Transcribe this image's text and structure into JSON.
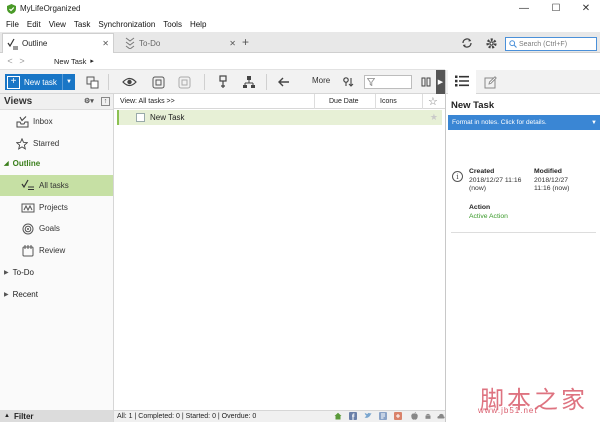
{
  "window": {
    "title": "MyLifeOrganized",
    "minimize": "—",
    "maximize": "☐",
    "close": "✕"
  },
  "menu": [
    "File",
    "Edit",
    "View",
    "Task",
    "Synchronization",
    "Tools",
    "Help"
  ],
  "tabs": [
    {
      "label": "Outline",
      "close": "✕",
      "active": true
    },
    {
      "label": "To-Do",
      "close": "✕",
      "active": false
    }
  ],
  "add_tab": "+",
  "search": {
    "placeholder": "Search (Ctrl+F)"
  },
  "breadcrumb": {
    "back": "<",
    "forward": ">",
    "current": "New Task",
    "arrow": "▸"
  },
  "toolbar": {
    "new_task_label": "New task",
    "more_label": "More"
  },
  "sidebar": {
    "title": "Views",
    "items": [
      {
        "label": "Inbox",
        "icon": "inbox-icon"
      },
      {
        "label": "Starred",
        "icon": "star-icon"
      }
    ],
    "outline_group": "Outline",
    "outline_items": [
      {
        "label": "All tasks",
        "icon": "all-tasks-icon",
        "selected": true
      },
      {
        "label": "Projects",
        "icon": "projects-icon"
      },
      {
        "label": "Goals",
        "icon": "goals-icon"
      },
      {
        "label": "Review",
        "icon": "review-icon"
      }
    ],
    "todo_group": "To-Do",
    "recent_group": "Recent",
    "filter_label": "Filter"
  },
  "main": {
    "columns": {
      "view": "View: All tasks >>",
      "due": "Due Date",
      "icons": "Icons"
    },
    "tasks": [
      {
        "name": "New Task"
      }
    ]
  },
  "statusbar": {
    "text": "All: 1 | Completed: 0 | Started: 0 | Overdue: 0"
  },
  "details": {
    "title": "New Task",
    "notes_hint": "Format in notes. Click  for details.",
    "created_label": "Created",
    "created_value": "2018/12/27 11:16",
    "created_rel": "(now)",
    "modified_label": "Modified",
    "modified_value": "2018/12/27",
    "modified_time": "11:16 (now)",
    "action_label": "Action",
    "action_value": "Active Action"
  },
  "watermark": {
    "text": "脚本之家",
    "url": "www.jb51.net"
  },
  "colors": {
    "accent": "#1976c6",
    "selected": "#c6e0a4",
    "green": "#3a7f1c",
    "notes": "#3a86d4"
  }
}
